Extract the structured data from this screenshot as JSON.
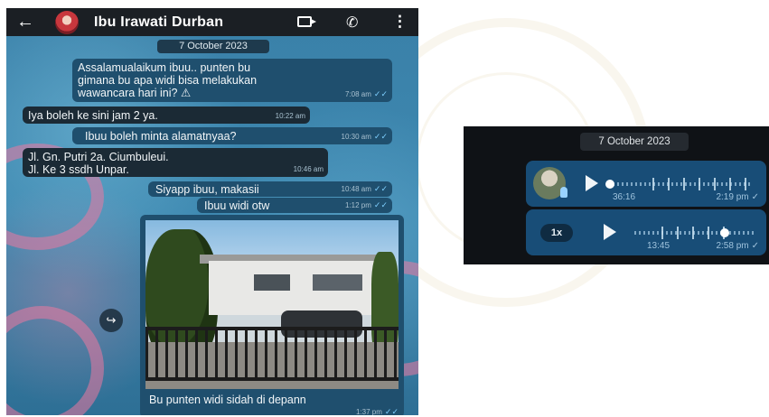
{
  "chat": {
    "contact_name": "Ibu Irawati Durban",
    "date_chip": "7 October 2023",
    "messages": [
      {
        "direction": "out",
        "line1": "Assalamualaikum ibuu.. punten bu",
        "line2": "gimana bu apa widi bisa melakukan",
        "line3": "wawancara hari ini? ⚠",
        "time": "7:08 am"
      },
      {
        "direction": "in",
        "text": "Iya boleh ke sini jam 2 ya.",
        "time": "10:22 am"
      },
      {
        "direction": "out",
        "text": "Ibuu boleh minta alamatnyaa?",
        "time": "10:30 am"
      },
      {
        "direction": "in",
        "line1": "Jl. Gn. Putri 2a. Ciumbuleui.",
        "line2": "Jl. Ke 3 ssdh Unpar.",
        "time": "10:46 am"
      },
      {
        "direction": "out",
        "text": "Siyapp ibuu, makasii",
        "time": "10:48 am"
      },
      {
        "direction": "out",
        "text": "Ibuu widi otw",
        "time": "1:12 pm"
      }
    ],
    "photo_message": {
      "caption": "Bu punten widi sidah di depann",
      "time": "1:37 pm"
    },
    "ticks": "✓✓"
  },
  "voice": {
    "date_chip": "7 October 2023",
    "notes": [
      {
        "duration": "36:16",
        "time": "2:19 pm",
        "progress": 0.0
      },
      {
        "speed": "1x",
        "duration": "13:45",
        "time": "2:58 pm",
        "progress": 0.74
      }
    ],
    "check": "✓"
  }
}
